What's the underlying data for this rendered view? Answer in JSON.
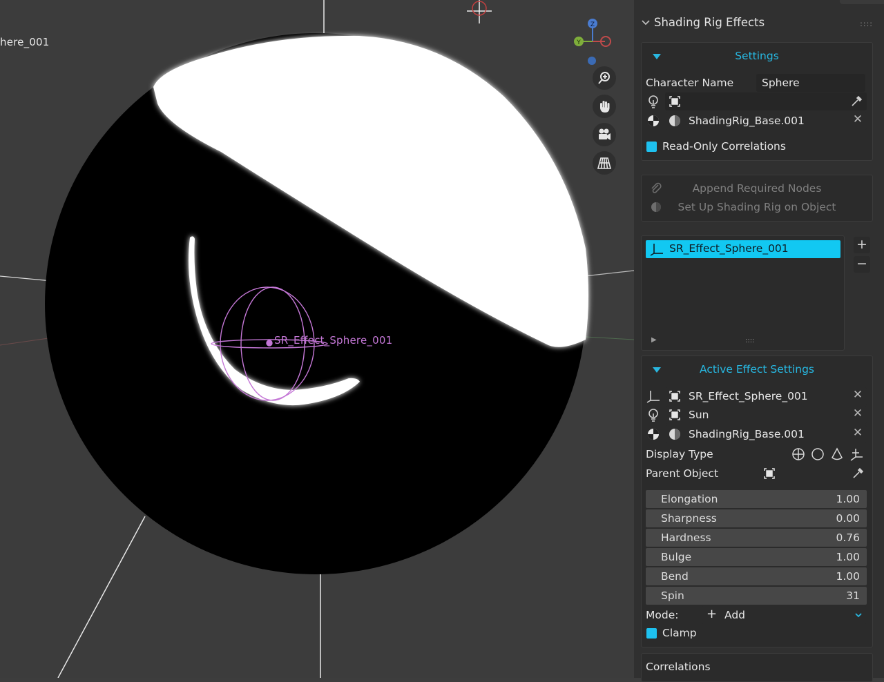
{
  "viewport": {
    "object_label": "here_001",
    "effect_label": "SR_Effect_Sphere_001",
    "gizmo": {
      "z": "Z",
      "y": "Y"
    }
  },
  "panel": {
    "title": "Shading Rig Effects",
    "settings": {
      "header": "Settings",
      "character_name_label": "Character Name",
      "character_name_value": "Sphere",
      "material_value": "ShadingRig_Base.001",
      "read_only_label": "Read-Only Correlations",
      "read_only_checked": true
    },
    "actions": {
      "append_label": "Append Required Nodes",
      "setup_label": "Set Up Shading Rig on Object"
    },
    "effects_list": {
      "items": [
        "SR_Effect_Sphere_001"
      ],
      "grip": "::::"
    },
    "active": {
      "header": "Active Effect Settings",
      "effect_value": "SR_Effect_Sphere_001",
      "light_value": "Sun",
      "material_value": "ShadingRig_Base.001",
      "display_type_label": "Display Type",
      "parent_object_label": "Parent Object",
      "properties": [
        {
          "name": "Elongation",
          "value": "1.00"
        },
        {
          "name": "Sharpness",
          "value": "0.00"
        },
        {
          "name": "Hardness",
          "value": "0.76"
        },
        {
          "name": "Bulge",
          "value": "1.00"
        },
        {
          "name": "Bend",
          "value": "1.00"
        },
        {
          "name": "Spin",
          "value": "31"
        }
      ],
      "mode_label": "Mode:",
      "mode_value": "Add",
      "clamp_label": "Clamp",
      "clamp_checked": true
    },
    "correlations_label": "Correlations"
  },
  "colors": {
    "accent": "#27b9e3",
    "selection": "#12c8f2",
    "empty_wire": "#c477d6"
  }
}
